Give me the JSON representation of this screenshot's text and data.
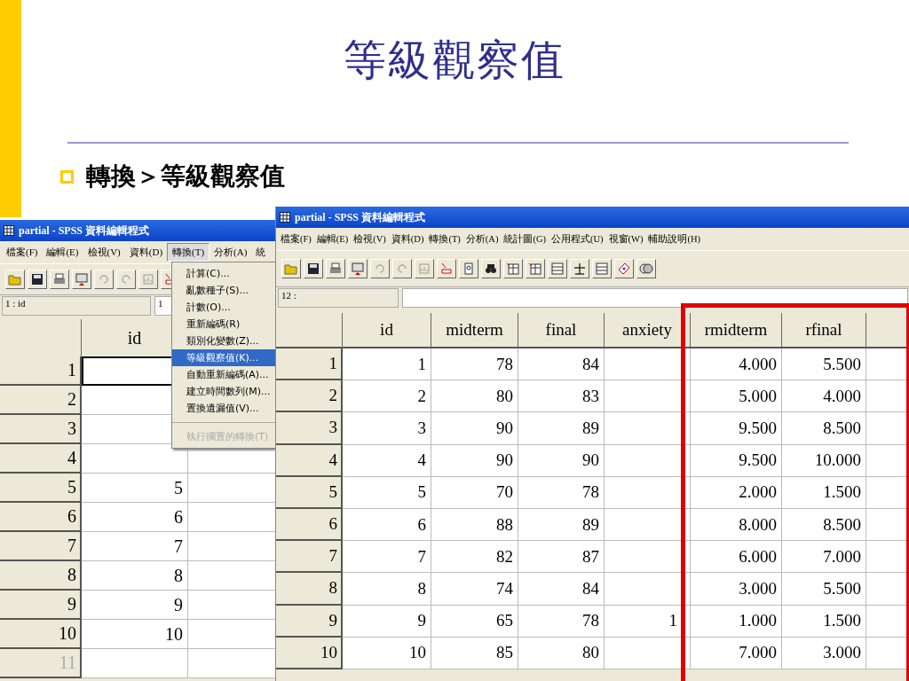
{
  "slide": {
    "title": "等級觀察值",
    "bullet": "轉換＞等級觀察值"
  },
  "left_window": {
    "title": "partial - SPSS 資料編輯程式",
    "menu": [
      {
        "label": "檔案(F)",
        "selected": false
      },
      {
        "label": "編輯(E)",
        "selected": false
      },
      {
        "label": "檢視(V)",
        "selected": false
      },
      {
        "label": "資料(D)",
        "selected": false
      },
      {
        "label": "轉換(T)",
        "selected": true
      },
      {
        "label": "分析(A)",
        "selected": false
      },
      {
        "label": "統",
        "selected": false
      }
    ],
    "cell_ref": "1 : id",
    "cell_value": "1",
    "columns": [
      "id"
    ],
    "rows": [
      {
        "label": "1",
        "active": true,
        "empty": false
      },
      {
        "label": "2",
        "active": false,
        "empty": false
      },
      {
        "label": "3",
        "active": false,
        "empty": false
      },
      {
        "label": "4",
        "active": false,
        "empty": false
      },
      {
        "label": "5",
        "id": "5",
        "active": false,
        "empty": false
      },
      {
        "label": "6",
        "id": "6",
        "active": false,
        "empty": false
      },
      {
        "label": "7",
        "id": "7",
        "active": false,
        "empty": false
      },
      {
        "label": "8",
        "id": "8",
        "active": false,
        "empty": false
      },
      {
        "label": "9",
        "id": "9",
        "active": false,
        "empty": false
      },
      {
        "label": "10",
        "id": "10",
        "active": false,
        "empty": false
      },
      {
        "label": "11",
        "active": false,
        "empty": true
      }
    ],
    "dropdown": [
      {
        "label": "計算(C)...",
        "selected": false,
        "disabled": false
      },
      {
        "label": "亂數種子(S)...",
        "selected": false,
        "disabled": false
      },
      {
        "label": "計數(O)...",
        "selected": false,
        "disabled": false
      },
      {
        "label": "重新編碼(R)",
        "selected": false,
        "disabled": false
      },
      {
        "label": "類別化變數(Z)...",
        "selected": false,
        "disabled": false
      },
      {
        "label": "等級觀察值(K)...",
        "selected": true,
        "disabled": false
      },
      {
        "label": "自動重新編碼(A)...",
        "selected": false,
        "disabled": false
      },
      {
        "label": "建立時間數列(M)...",
        "selected": false,
        "disabled": false
      },
      {
        "label": "置換遺漏值(V)...",
        "selected": false,
        "disabled": false
      },
      {
        "label": "執行擱置的轉換(T)",
        "selected": false,
        "disabled": true
      }
    ]
  },
  "right_window": {
    "title": "partial - SPSS 資料編輯程式",
    "menu": [
      "檔案(F)",
      "編輯(E)",
      "檢視(V)",
      "資料(D)",
      "轉換(T)",
      "分析(A)",
      "統計圖(G)",
      "公用程式(U)",
      "視窗(W)",
      "輔助說明(H)"
    ],
    "cell_ref": "12 :",
    "columns": [
      "id",
      "midterm",
      "final",
      "anxiety",
      "rmidterm",
      "rfinal"
    ],
    "rows": [
      {
        "label": "1",
        "id": "1",
        "midterm": "78",
        "final": "84",
        "rmidterm": "4.000",
        "rfinal": "5.500"
      },
      {
        "label": "2",
        "id": "2",
        "midterm": "80",
        "final": "83",
        "rmidterm": "5.000",
        "rfinal": "4.000"
      },
      {
        "label": "3",
        "id": "3",
        "midterm": "90",
        "final": "89",
        "rmidterm": "9.500",
        "rfinal": "8.500"
      },
      {
        "label": "4",
        "id": "4",
        "midterm": "90",
        "final": "90",
        "rmidterm": "9.500",
        "rfinal": "10.000"
      },
      {
        "label": "5",
        "id": "5",
        "midterm": "70",
        "final": "78",
        "rmidterm": "2.000",
        "rfinal": "1.500"
      },
      {
        "label": "6",
        "id": "6",
        "midterm": "88",
        "final": "89",
        "rmidterm": "8.000",
        "rfinal": "8.500"
      },
      {
        "label": "7",
        "id": "7",
        "midterm": "82",
        "final": "87",
        "rmidterm": "6.000",
        "rfinal": "7.000"
      },
      {
        "label": "8",
        "id": "8",
        "midterm": "74",
        "final": "84",
        "rmidterm": "3.000",
        "rfinal": "5.500"
      },
      {
        "label": "9",
        "id": "9",
        "midterm": "65",
        "final": "78",
        "anxiety": "1",
        "rmidterm": "1.000",
        "rfinal": "1.500"
      },
      {
        "label": "10",
        "id": "10",
        "midterm": "85",
        "final": "80",
        "rmidterm": "7.000",
        "rfinal": "3.000"
      }
    ]
  }
}
